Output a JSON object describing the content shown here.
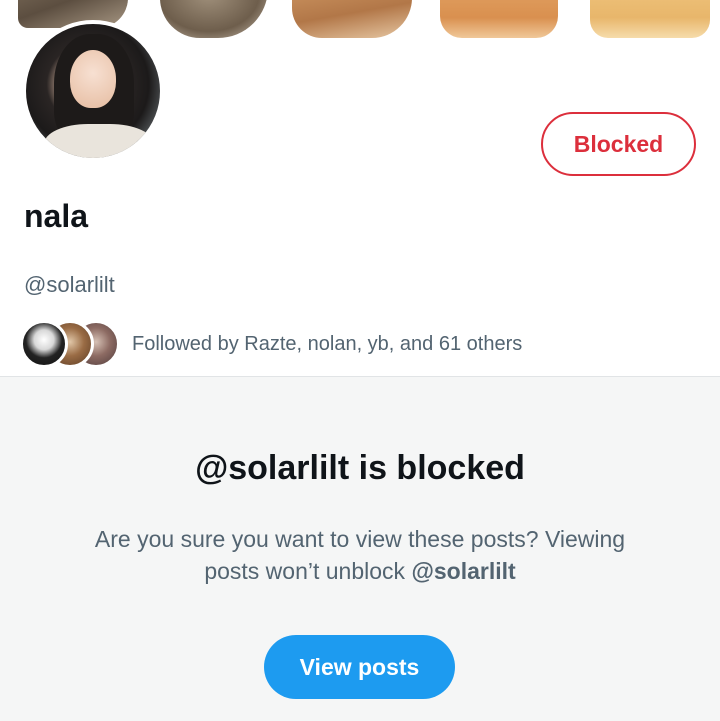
{
  "profile": {
    "display_name": "nala",
    "handle": "@solarlilt",
    "block_button_label": "Blocked",
    "followed_by_text": "Followed by Razte, nolan, yb, and 61 others"
  },
  "blocked_notice": {
    "title": "@solarlilt is blocked",
    "description_prefix": "Are you sure you want to view these posts? Viewing posts won’t unblock ",
    "description_handle": "@solarlilt",
    "view_button_label": "View posts"
  },
  "colors": {
    "blocked_red": "#dc2f3c",
    "view_blue": "#1d9bf0",
    "secondary_text": "#536471",
    "panel_bg": "#f5f6f6"
  }
}
